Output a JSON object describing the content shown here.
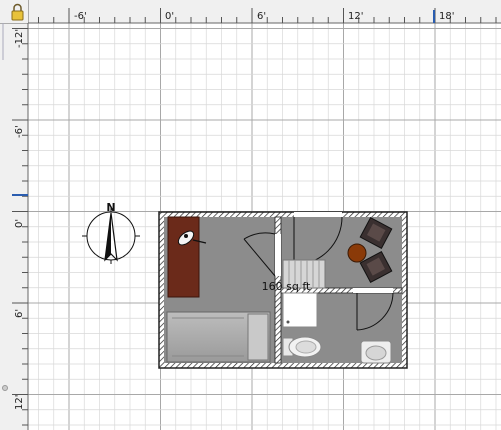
{
  "rulers": {
    "horizontal_labels": [
      "-6'",
      "0'",
      "6'",
      "12'",
      "18'"
    ],
    "vertical_labels": [
      "-12'",
      "-6'",
      "0'",
      "6'",
      "12'"
    ]
  },
  "compass": {
    "north_label": "N"
  },
  "room": {
    "area_label": "160 sq ft"
  },
  "colors": {
    "grid_minor": "#d8d8d8",
    "grid_major": "#a8a8a8",
    "room_floor": "#8c8c8c",
    "wall": "#222222",
    "ruler_bg": "#f0f0f0",
    "selection_marker": "#2a5db0",
    "wood": "#6b2a1a"
  },
  "icons": {
    "corner": "lock-icon",
    "compass": "compass-rose-icon"
  }
}
